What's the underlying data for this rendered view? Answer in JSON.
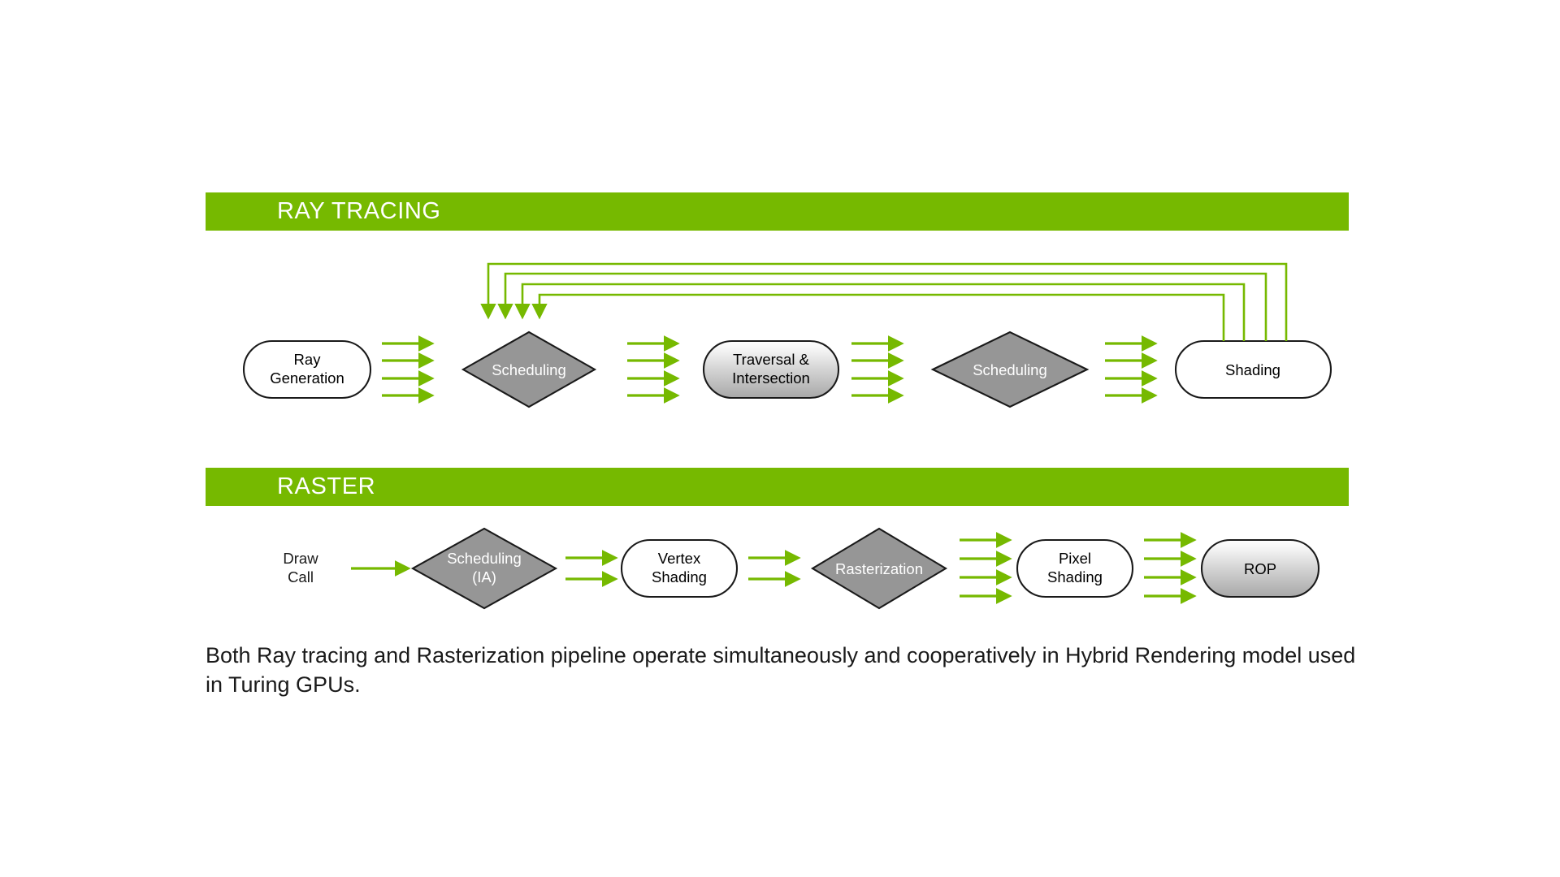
{
  "slide": {
    "background_color": "#ffffff",
    "accent_color": "#76b900",
    "node_gray": "#969696",
    "border_color": "#1a1a1a"
  },
  "sections": [
    {
      "id": "ray-tracing",
      "band_label": "RAY TRACING",
      "nodes": [
        {
          "id": "ray-generation",
          "label": "Ray\nGeneration",
          "line1": "Ray",
          "line2": "Generation",
          "shape": "stadium",
          "fill": "white"
        },
        {
          "id": "scheduling-1",
          "label": "Scheduling",
          "line1": "Scheduling",
          "line2": "",
          "shape": "diamond",
          "fill": "gray"
        },
        {
          "id": "traversal-intersection",
          "label": "Traversal &\nIntersection",
          "line1": "Traversal &",
          "line2": "Intersection",
          "shape": "stadium",
          "fill": "gradient-gray"
        },
        {
          "id": "scheduling-2",
          "label": "Scheduling",
          "line1": "Scheduling",
          "line2": "",
          "shape": "diamond",
          "fill": "gray"
        },
        {
          "id": "shading",
          "label": "Shading",
          "line1": "Shading",
          "line2": "",
          "shape": "stadium",
          "fill": "white"
        }
      ],
      "connectors": [
        {
          "from": "ray-generation",
          "to": "scheduling-1",
          "arrow_count": 4
        },
        {
          "from": "scheduling-1",
          "to": "traversal-intersection",
          "arrow_count": 4
        },
        {
          "from": "traversal-intersection",
          "to": "scheduling-2",
          "arrow_count": 4
        },
        {
          "from": "scheduling-2",
          "to": "shading",
          "arrow_count": 4
        }
      ],
      "feedback_loops": {
        "count": 4,
        "from": "shading",
        "to": "scheduling-1",
        "direction": "down"
      }
    },
    {
      "id": "raster",
      "band_label": "RASTER",
      "nodes": [
        {
          "id": "draw-call",
          "label": "Draw\nCall",
          "line1": "Draw",
          "line2": "Call",
          "shape": "text",
          "fill": "none"
        },
        {
          "id": "scheduling-ia",
          "label": "Scheduling\n(IA)",
          "line1": "Scheduling",
          "line2": "(IA)",
          "shape": "diamond",
          "fill": "gray"
        },
        {
          "id": "vertex-shading",
          "label": "Vertex\nShading",
          "line1": "Vertex",
          "line2": "Shading",
          "shape": "stadium",
          "fill": "white"
        },
        {
          "id": "rasterization",
          "label": "Rasterization",
          "line1": "Rasterization",
          "line2": "",
          "shape": "diamond",
          "fill": "gray"
        },
        {
          "id": "pixel-shading",
          "label": "Pixel\nShading",
          "line1": "Pixel",
          "line2": "Shading",
          "shape": "stadium",
          "fill": "white"
        },
        {
          "id": "rop",
          "label": "ROP",
          "line1": "ROP",
          "line2": "",
          "shape": "stadium",
          "fill": "gradient-gray"
        }
      ],
      "connectors": [
        {
          "from": "draw-call",
          "to": "scheduling-ia",
          "arrow_count": 1
        },
        {
          "from": "scheduling-ia",
          "to": "vertex-shading",
          "arrow_count": 2
        },
        {
          "from": "vertex-shading",
          "to": "rasterization",
          "arrow_count": 2
        },
        {
          "from": "rasterization",
          "to": "pixel-shading",
          "arrow_count": 4
        },
        {
          "from": "pixel-shading",
          "to": "rop",
          "arrow_count": 4
        }
      ],
      "feedback_loops": {
        "count": 0
      }
    }
  ],
  "caption": {
    "text": "Both Ray tracing and Rasterization pipeline operate simultaneously and cooperatively in Hybrid Rendering model used in Turing GPUs."
  }
}
